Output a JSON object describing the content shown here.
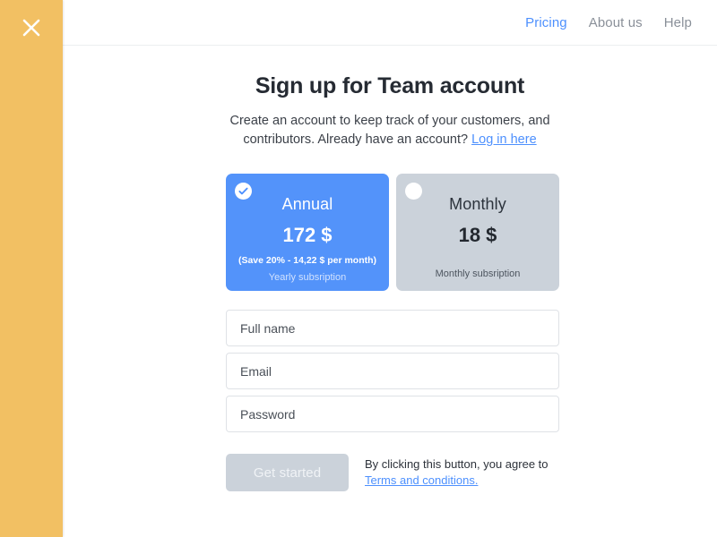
{
  "window": {
    "close_icon": "close-icon"
  },
  "nav": {
    "items": [
      {
        "label": "Pricing",
        "active": true
      },
      {
        "label": "About us",
        "active": false
      },
      {
        "label": "Help",
        "active": false
      }
    ]
  },
  "hero": {
    "title": "Sign up for Team account",
    "description_line1": "Create an account to keep track of your customers, and",
    "description_line2": "contributors. Already have an account?",
    "login_link": "Log in here"
  },
  "plans": [
    {
      "id": "annual",
      "name": "Annual",
      "price": "172 $",
      "save_text": "(Save 20% - 14,22 $ per month)",
      "note": "Yearly subsription",
      "selected": true,
      "marker_icon": "check-circle-icon",
      "bg_color": "#5393fa"
    },
    {
      "id": "monthly",
      "name": "Monthly",
      "price": "18 $",
      "save_text": "",
      "note": "Monthly subsription",
      "selected": false,
      "marker_icon": "radio-empty-icon",
      "bg_color": "#cbd2da"
    }
  ],
  "form": {
    "fields": [
      {
        "name": "full-name",
        "placeholder": "Full name",
        "value": "",
        "type": "text"
      },
      {
        "name": "email",
        "placeholder": "Email",
        "value": "",
        "type": "text"
      },
      {
        "name": "password",
        "placeholder": "Password",
        "value": "",
        "type": "text"
      }
    ],
    "submit_label": "Get started",
    "terms_text": "By clicking this button, you agree to",
    "terms_link": "Terms and conditions."
  },
  "colors": {
    "rail": "#f2c063",
    "accent_blue": "#4d90fe",
    "plan_blue": "#5393fa",
    "plan_gray": "#cbd2da"
  }
}
